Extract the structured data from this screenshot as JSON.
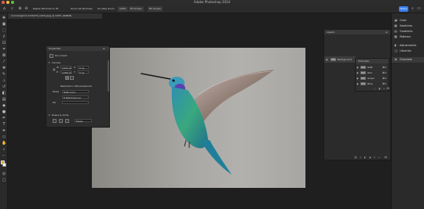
{
  "window": {
    "title": "Adobe Photoshop 2024"
  },
  "options_bar": {
    "resize_windows": "Resize Windows to Fit",
    "zoom_all": "Zoom All Windows",
    "scrubby_zoom": "Scrubby Zoom",
    "zoom_100": "100%",
    "fit_screen": "Fit Screen",
    "fill_screen": "Fill Screen",
    "share_label": "Share"
  },
  "document": {
    "tab_label": "hummingbird-2139279_1920.jpeg @ 100% (RGB/8)"
  },
  "properties": {
    "title": "Properties",
    "section_document": "Document",
    "section_canvas": "Canvas",
    "width_label": "W",
    "width_value": "1920 px",
    "height_label": "H",
    "height_value": "1280 px",
    "x_label": "X",
    "x_value": "0 px",
    "y_label": "Y",
    "y_value": "0 px",
    "resolution": "Resolution: 300 pixels/inch",
    "mode_label": "Mode",
    "mode_value": "RGB Color",
    "depth_value": "8 Bits/Channel",
    "fill_label": "Fill",
    "rulers_grids": "Rulers & Grids",
    "pixels_value": "Pixels"
  },
  "right_panel": {
    "items": [
      {
        "label": "Color",
        "icon": "color-wheel-icon"
      },
      {
        "label": "Swatches",
        "icon": "swatches-icon"
      },
      {
        "label": "Gradients",
        "icon": "gradient-icon"
      },
      {
        "label": "Patterns",
        "icon": "patterns-icon"
      },
      {
        "label": "Adjustments",
        "icon": "adjustments-icon"
      },
      {
        "label": "Libraries",
        "icon": "libraries-icon"
      },
      {
        "label": "Channels",
        "icon": "channels-icon"
      }
    ]
  },
  "layers": {
    "title": "Layers",
    "background_label": "Background"
  },
  "channels": {
    "title": "Channels",
    "rows": [
      {
        "name": "RGB",
        "shortcut": "⌘2"
      },
      {
        "name": "Red",
        "shortcut": "⌘3"
      },
      {
        "name": "Green",
        "shortcut": "⌘4"
      },
      {
        "name": "Blue",
        "shortcut": "⌘5"
      }
    ]
  },
  "colors": {
    "foreground": "#e3a332",
    "background": "#ffffff",
    "accent": "#3b7ff0"
  }
}
